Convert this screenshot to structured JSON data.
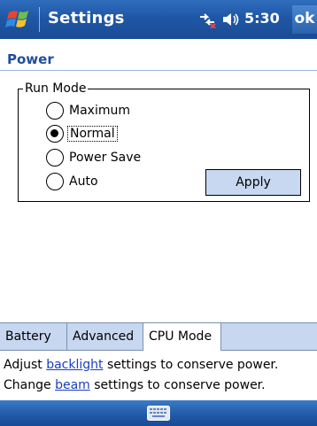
{
  "titlebar": {
    "app_title": "Settings",
    "clock": "5:30",
    "ok_label": "ok",
    "start_icon": "windows-flag-icon",
    "connectivity_icon": "connectivity-icon",
    "volume_icon": "speaker-icon"
  },
  "page": {
    "title": "Power"
  },
  "run_mode": {
    "legend": "Run Mode",
    "options": [
      {
        "label": "Maximum",
        "checked": false
      },
      {
        "label": "Normal",
        "checked": true
      },
      {
        "label": "Power Save",
        "checked": false
      },
      {
        "label": "Auto",
        "checked": false
      }
    ],
    "apply_label": "Apply"
  },
  "tabs": [
    {
      "label": "Battery",
      "active": false
    },
    {
      "label": "Advanced",
      "active": false
    },
    {
      "label": "CPU Mode",
      "active": true
    }
  ],
  "info": {
    "line1_prefix": "Adjust ",
    "line1_link": "backlight",
    "line1_suffix": " settings to conserve power.",
    "line2_prefix": "Change ",
    "line2_link": "beam",
    "line2_suffix": " settings to conserve power."
  },
  "bottombar": {
    "keyboard_icon": "keyboard-icon"
  },
  "colors": {
    "titlebar": "#1f57a6",
    "page_title": "#1f4e9a",
    "tabbar": "#c7d7ef",
    "apply_button": "#c8d8f0",
    "link": "#1a3fbf"
  }
}
